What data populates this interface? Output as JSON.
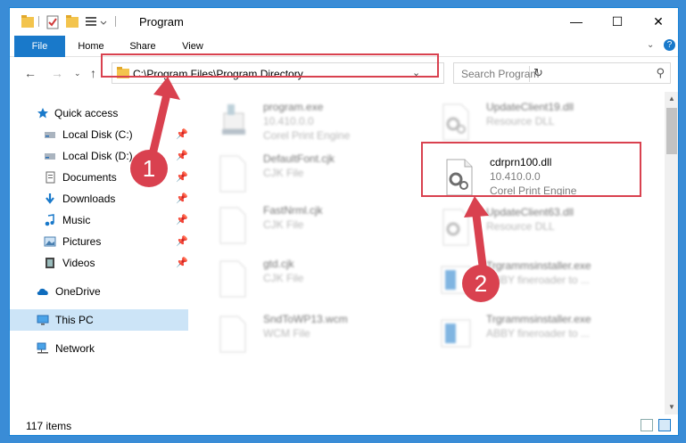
{
  "window": {
    "title": "Program",
    "controls": {
      "minimize": "—",
      "maximize": "☐",
      "close": "✕"
    }
  },
  "ribbon": {
    "tabs": [
      "File",
      "Home",
      "Share",
      "View"
    ],
    "expand_icon": "chevron-down",
    "help_icon": "help"
  },
  "address_bar": {
    "path": "C:\\Program Files\\Program Directory",
    "search_placeholder": "Search Program"
  },
  "nav_pane": {
    "items": [
      {
        "label": "Quick access",
        "icon": "star-icon",
        "pinned": false
      },
      {
        "label": "Local Disk (C:)",
        "icon": "drive-icon",
        "pinned": true
      },
      {
        "label": "Local Disk (D:)",
        "icon": "drive-icon",
        "pinned": true
      },
      {
        "label": "Documents",
        "icon": "documents-icon",
        "pinned": true
      },
      {
        "label": "Downloads",
        "icon": "download-icon",
        "pinned": true
      },
      {
        "label": "Music",
        "icon": "music-icon",
        "pinned": true
      },
      {
        "label": "Pictures",
        "icon": "pictures-icon",
        "pinned": true
      },
      {
        "label": "Videos",
        "icon": "videos-icon",
        "pinned": true
      },
      {
        "label": "OneDrive",
        "icon": "cloud-icon",
        "pinned": false
      },
      {
        "label": "This PC",
        "icon": "pc-icon",
        "pinned": false,
        "selected": true
      },
      {
        "label": "Network",
        "icon": "network-icon",
        "pinned": false
      }
    ]
  },
  "files": {
    "left": [
      {
        "name": "program.exe",
        "line1": "10.410.0.0",
        "line2": "Corel Print Engine",
        "icon": "exe-icon"
      },
      {
        "name": "DefaultFont.cjk",
        "line1": "CJK File",
        "line2": "",
        "icon": "blank-file-icon"
      },
      {
        "name": "FastNrml.cjk",
        "line1": "CJK File",
        "line2": "",
        "icon": "blank-file-icon"
      },
      {
        "name": "gtd.cjk",
        "line1": "CJK File",
        "line2": "",
        "icon": "blank-file-icon"
      },
      {
        "name": "SndToWP13.wcm",
        "line1": "WCM File",
        "line2": "",
        "icon": "blank-file-icon"
      }
    ],
    "right": [
      {
        "name": "UpdateClient19.dll",
        "line1": "Resource DLL",
        "line2": "",
        "icon": "dll-icon"
      },
      {
        "name": "cdrprn100.dll",
        "line1": "10.410.0.0",
        "line2": "Corel Print Engine",
        "icon": "dll-icon",
        "highlight": true
      },
      {
        "name": "UpdateClient63.dll",
        "line1": "Resource DLL",
        "line2": "",
        "icon": "dll-icon"
      },
      {
        "name": "Trgrammsinstaller.exe",
        "line1": "ABBY fineroader to ...",
        "line2": "",
        "icon": "installer-icon"
      },
      {
        "name": "Trgrammsinstaller.exe",
        "line1": "ABBY fineroader to ...",
        "line2": "",
        "icon": "installer-icon"
      }
    ]
  },
  "status": {
    "item_count": "117 items"
  },
  "callouts": {
    "one": "1",
    "two": "2"
  },
  "colors": {
    "accent": "#1979ca",
    "highlight": "#d9414f",
    "selection": "#cce4f7"
  }
}
